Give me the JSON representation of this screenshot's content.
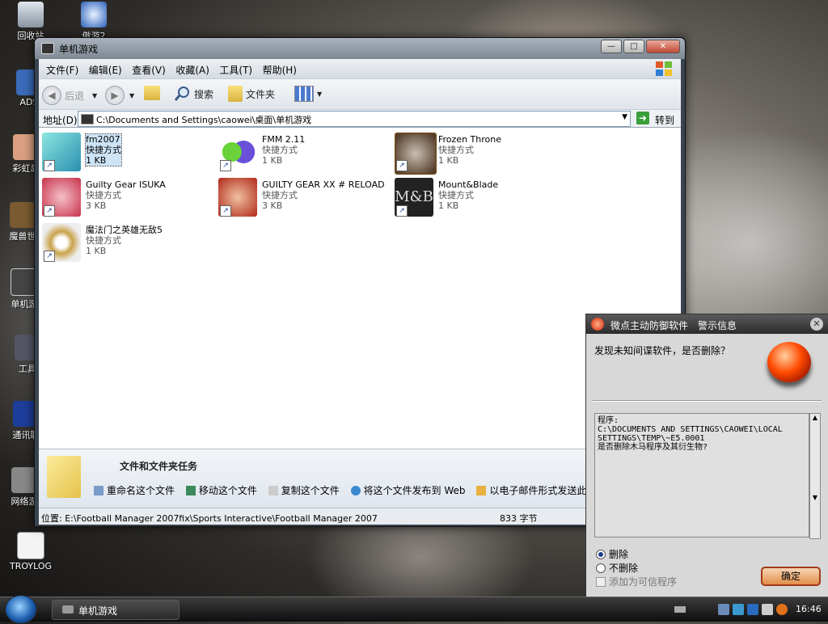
{
  "desktop": {
    "icons": [
      {
        "label": "回收站"
      },
      {
        "label": "傲游2"
      },
      {
        "label": "ADS"
      },
      {
        "label": "彩虹岛"
      },
      {
        "label": "魔兽世"
      },
      {
        "label": "单机游"
      },
      {
        "label": "工具"
      },
      {
        "label": "通讯联"
      },
      {
        "label": "网络游"
      },
      {
        "label": "TROYLOG"
      }
    ]
  },
  "window": {
    "title": "单机游戏",
    "menu": [
      "文件(F)",
      "编辑(E)",
      "查看(V)",
      "收藏(A)",
      "工具(T)",
      "帮助(H)"
    ],
    "toolbar": {
      "back": "后退",
      "search": "搜索",
      "folders": "文件夹"
    },
    "address": {
      "label": "地址(D)",
      "value": "C:\\Documents and Settings\\caowei\\桌面\\单机游戏",
      "go": "转到"
    },
    "items": [
      {
        "name": "fm2007",
        "type": "快捷方式",
        "size": "1 KB",
        "color": "#2c8fb0"
      },
      {
        "name": "FMM 2.11",
        "type": "快捷方式",
        "size": "1 KB",
        "color": "#6a4fd8"
      },
      {
        "name": "Frozen Throne",
        "type": "快捷方式",
        "size": "1 KB",
        "color": "#4a3020"
      },
      {
        "name": "Guilty Gear ISUKA",
        "type": "快捷方式",
        "size": "3 KB",
        "color": "#c8324a"
      },
      {
        "name": "GUILTY GEAR XX # RELOAD",
        "type": "快捷方式",
        "size": "3 KB",
        "color": "#b02818"
      },
      {
        "name": "Mount&Blade",
        "type": "快捷方式",
        "size": "1 KB",
        "color": "#222222"
      },
      {
        "name": "魔法门之英雄无敌5",
        "type": "快捷方式",
        "size": "1 KB",
        "color": "#c9a24a"
      }
    ],
    "tasks": {
      "title": "文件和文件夹任务",
      "links": [
        "重命名这个文件",
        "移动这个文件",
        "复制这个文件",
        "将这个文件发布到 Web",
        "以电子邮件形式发送此文"
      ]
    },
    "status": {
      "location": "位置: E:\\Football Manager 2007fix\\Sports Interactive\\Football Manager 2007",
      "size": "833 字节"
    }
  },
  "alert": {
    "title": "微点主动防御软件　警示信息",
    "question": "发现未知间谍软件，是否删除？",
    "details": "程序:\nC:\\DOCUMENTS AND SETTINGS\\CAOWEI\\LOCAL SETTINGS\\TEMP\\~E5.0001\n是否删除木马程序及其衍生物?",
    "option_delete": "删除",
    "option_keep": "不删除",
    "trust": "添加为可信程序",
    "ok": "确定"
  },
  "taskbar": {
    "item": "单机游戏",
    "clock": "16:46"
  }
}
